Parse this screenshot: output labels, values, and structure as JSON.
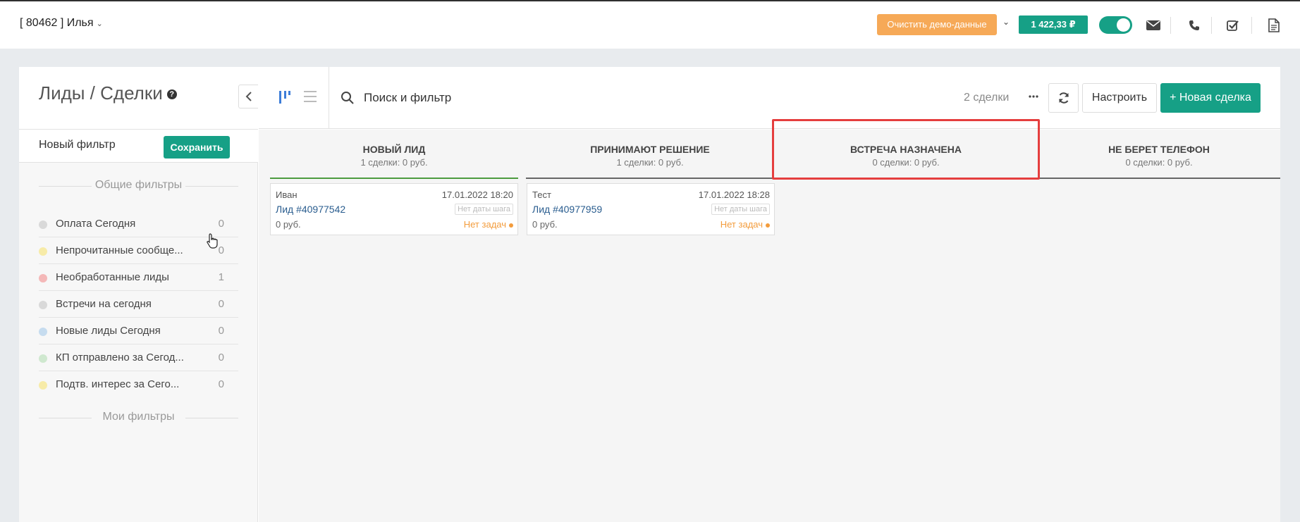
{
  "header": {
    "user": "[ 80462 ] Илья",
    "demo_button": "Очистить демо-данные",
    "balance": "1 422,33 ₽"
  },
  "sidebar": {
    "title": "Лиды / Сделки",
    "new_filter": "Новый фильтр",
    "save": "Сохранить",
    "common_filters_title": "Общие фильтры",
    "my_filters_title": "Мои фильтры",
    "filters": [
      {
        "label": "Оплата Сегодня",
        "count": "0",
        "color": "#d9d9d9"
      },
      {
        "label": "Непрочитанные сообще...",
        "count": "0",
        "color": "#f7eba8"
      },
      {
        "label": "Необработанные лиды",
        "count": "1",
        "color": "#f4b8b8"
      },
      {
        "label": "Встречи на сегодня",
        "count": "0",
        "color": "#d9d9d9"
      },
      {
        "label": "Новые лиды Сегодня",
        "count": "0",
        "color": "#c6dcef"
      },
      {
        "label": "КП отправлено за Сегод...",
        "count": "0",
        "color": "#cfe8cf"
      },
      {
        "label": "Подтв. интерес за Сего...",
        "count": "0",
        "color": "#f7eba8"
      }
    ]
  },
  "toolbar": {
    "search_placeholder": "Поиск и фильтр",
    "deals_count": "2 сделки",
    "settings": "Настроить",
    "new_deal": "+ Новая сделка"
  },
  "columns": [
    {
      "title": "НОВЫЙ ЛИД",
      "sub": "1 сделки: 0 руб."
    },
    {
      "title": "ПРИНИМАЮТ РЕШЕНИЕ",
      "sub": "1 сделки: 0 руб."
    },
    {
      "title": "ВСТРЕЧА НАЗНАЧЕНА",
      "sub": "0 сделки: 0 руб."
    },
    {
      "title": "НЕ БЕРЕТ ТЕЛЕФОН",
      "sub": "0 сделки: 0 руб."
    }
  ],
  "cards": [
    {
      "name": "Иван",
      "date": "17.01.2022 18:20",
      "lead": "Лид #40977542",
      "no_date": "Нет даты шага",
      "sum": "0 руб.",
      "tasks": "Нет задач"
    },
    {
      "name": "Тест",
      "date": "17.01.2022 18:28",
      "lead": "Лид #40977959",
      "no_date": "Нет даты шага",
      "sum": "0 руб.",
      "tasks": "Нет задач"
    }
  ],
  "colors": {
    "accent": "#16a086",
    "demo": "#f6a957",
    "highlight": "#e53e3e"
  }
}
